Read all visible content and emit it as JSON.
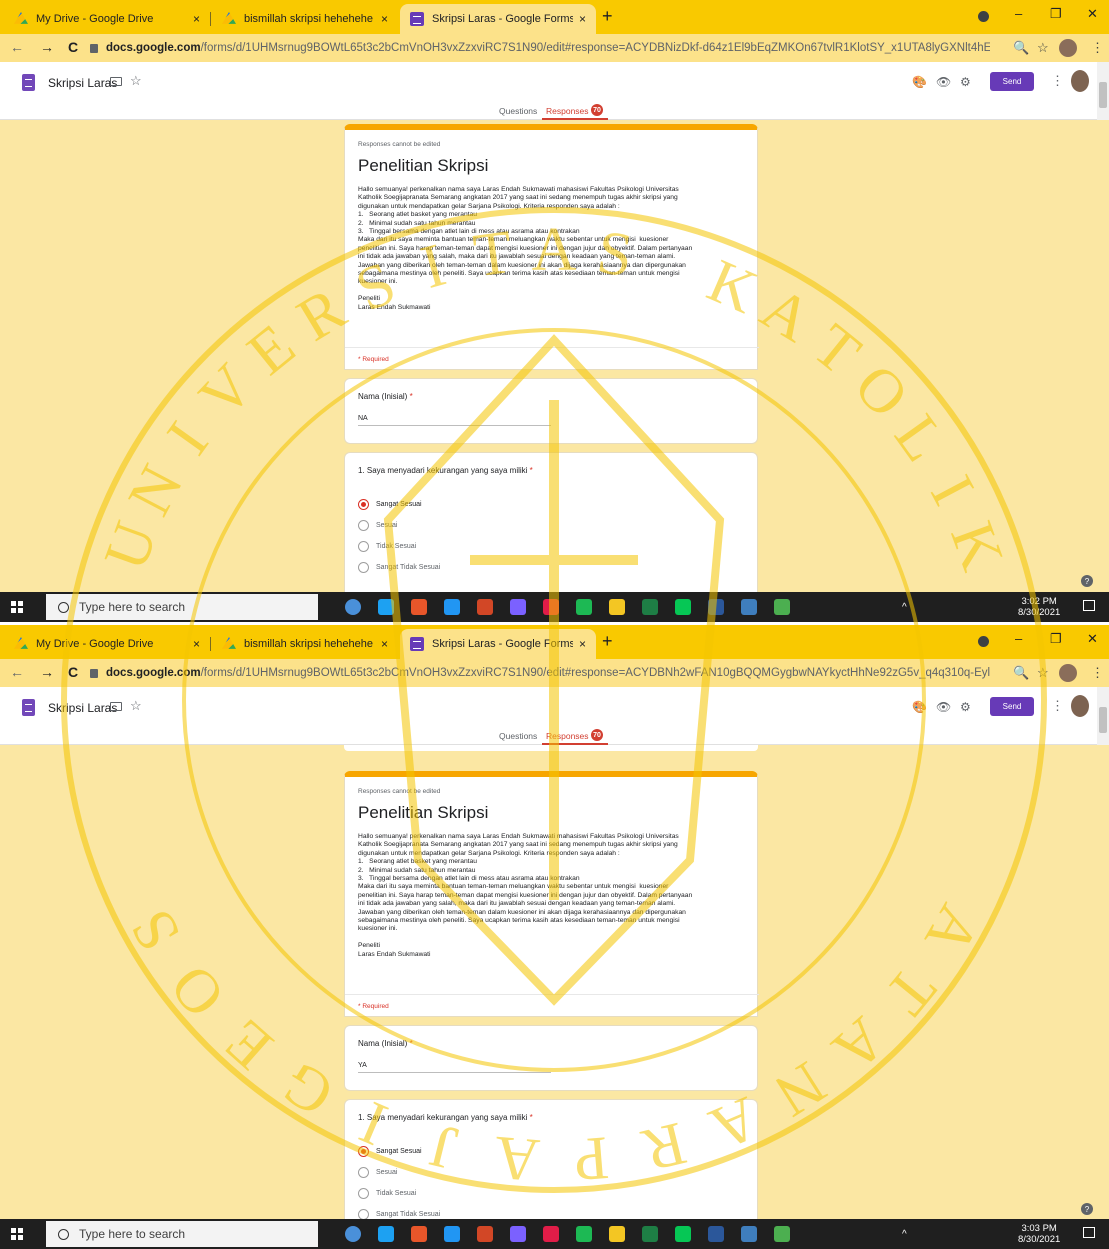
{
  "tabs": [
    {
      "label": "My Drive - Google Drive",
      "icon": "drive-icon"
    },
    {
      "label": "bismillah skripsi hehehehe - Goo",
      "icon": "drive-icon"
    },
    {
      "label": "Skripsi Laras - Google Forms",
      "icon": "forms-icon"
    }
  ],
  "close_glyph": "×",
  "newtab_glyph": "+",
  "window_controls": {
    "minimize": "–",
    "maximize": "❐",
    "close": "✕"
  },
  "nav": {
    "back": "←",
    "forward": "→",
    "reload": "C"
  },
  "address": {
    "host": "docs.google.com",
    "path_1": "/forms/d/1UHMsrnug9BOWtL65t3c2bCmVnOH3vxZzxviRC7S1N90/edit#response=ACYDBNizDkf-d64z1El9bEqZMKOn67tvlR1KlotSY_x1UTA8lyGXNlt4hEoVt...",
    "path_2": "/forms/d/1UHMsrnug9BOWtL65t3c2bCmVnOH3vxZzxviRC7S1N90/edit#response=ACYDBNh2wFAN10gBQQMGygbwNAYkyctHhNe92zG5v_q4q310q-Eylhi8..."
  },
  "address_icons": {
    "zoom": "🔍",
    "bookmark": "☆",
    "menu": "⋮"
  },
  "forms_header": {
    "doc_title": "Skripsi Laras",
    "star": "☆",
    "palette": "🎨",
    "preview": "👁",
    "settings": "⚙",
    "send_label": "Send",
    "more": "⋮"
  },
  "subtabs": {
    "questions": "Questions",
    "responses": "Responses",
    "responses_count": "70"
  },
  "form": {
    "readonly_note": "Responses cannot be edited",
    "title": "Penelitian Skripsi",
    "description": "Hallo semuanya! perkenalkan nama saya Laras Endah Sukmawati mahasiswi Fakultas Psikologi Universitas\nKatholik Soegijapranata Semarang angkatan 2017 yang saat ini sedang menempuh tugas akhir skripsi yang\ndigunakan untuk mendapatkan gelar Sarjana Psikologi. Kriteria responden saya adalah :\n1.   Seorang atlet basket yang merantau\n2.   Minimal sudah satu tahun merantau\n3.   Tinggal bersama dengan atlet lain di mess atau asrama atau kontrakan\nMaka dari itu saya meminta bantuan teman-teman meluangkan waktu sebentar untuk mengisi  kuesioner\npenelitian ini. Saya harap teman-teman dapat mengisi kuesioner ini dengan jujur dan obyektif. Dalam pertanyaan\nini tidak ada jawaban yang salah, maka dari itu jawablah sesuai dengan keadaan yang teman-teman alami.\nJawaban yang diberikan oleh teman-teman dalam kuesioner ini akan dijaga kerahasiaannya dan dipergunakan\nsebagaimana mestinya oleh peneliti. Saya ucapkan terima kasih atas kesediaan teman-teman untuk mengisi\nkuesioner ini.\n\nPeneliti\nLaras Endah Sukmawati",
    "required_note": "* Required",
    "q_name_label": "Nama (Inisial)",
    "required_star": "*",
    "q1_label": "1. Saya menyadari kekurangan yang saya miliki",
    "options": [
      "Sangat Sesuai",
      "Sesuai",
      "Tidak Sesuai",
      "Sangat Tidak Sesuai"
    ],
    "help_glyph": "?"
  },
  "shots": [
    {
      "name_answer": "NA",
      "selected_option": "Sangat Sesuai",
      "time": "3:02 PM",
      "date": "8/30/2021"
    },
    {
      "name_answer": "YA",
      "selected_option": "Sangat Sesuai",
      "time": "3:03 PM",
      "date": "8/30/2021"
    }
  ],
  "taskbar": {
    "search_placeholder": "Type here to search",
    "tray_up": "^",
    "tray_colors": [
      "#4a90d9",
      "#1da1f2",
      "#e8562a",
      "#2196f3",
      "#d24726",
      "#7b61ff",
      "#e11d48",
      "#1db954",
      "#f3c623",
      "#1e7e45",
      "#06c755",
      "#2b579a",
      "#3f7ebd",
      "#4caf50"
    ]
  },
  "watermark": {
    "text_top": "UNIVERSITAS KATOLIK",
    "text_bottom": "SOEGIJAPRANATA",
    "color": "#f4c400"
  }
}
